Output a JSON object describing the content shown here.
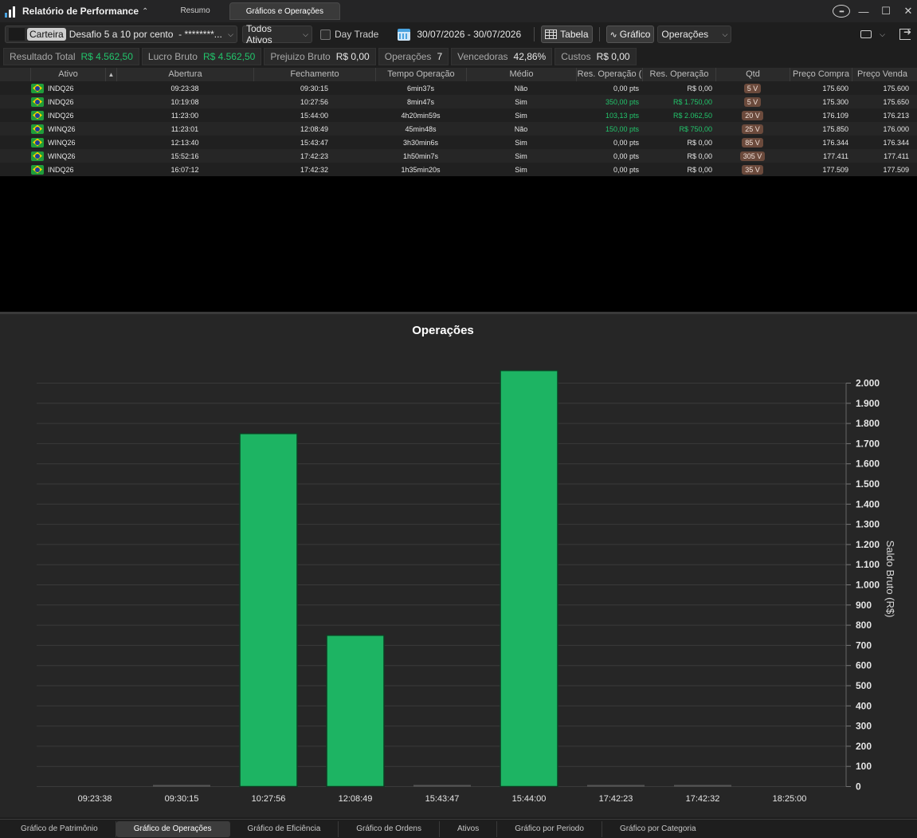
{
  "app": {
    "title": "Relatório de Performance",
    "tabs": [
      {
        "label": "Resumo",
        "active": false
      },
      {
        "label": "Gráficos e Operações",
        "active": true
      }
    ]
  },
  "toolbar": {
    "carteira_label": "Carteira",
    "carteira_value": "Desafio 5 a 10 por cento  - ********...",
    "ativos_select": "Todos Ativos",
    "day_trade_label": "Day Trade",
    "day_trade_checked": false,
    "date_range": "30/07/2026 - 30/07/2026",
    "tabela_label": "Tabela",
    "grafico_label": "Gráfico",
    "view_select": "Operações"
  },
  "summary": [
    {
      "label": "Resultado Total",
      "value": "R$ 4.562,50",
      "color": "green"
    },
    {
      "label": "Lucro Bruto",
      "value": "R$ 4.562,50",
      "color": "green"
    },
    {
      "label": "Prejuizo Bruto",
      "value": "R$ 0,00",
      "color": "normal"
    },
    {
      "label": "Operações",
      "value": "7",
      "color": "normal"
    },
    {
      "label": "Vencedoras",
      "value": "42,86%",
      "color": "normal"
    },
    {
      "label": "Custos",
      "value": "R$ 0,00",
      "color": "normal"
    }
  ],
  "table": {
    "headers": {
      "ativo": "Ativo",
      "abertura": "Abertura",
      "fechamento": "Fechamento",
      "tempo": "Tempo Operação",
      "medio": "Médio",
      "res_pts": "Res. Operação (",
      "res_brl": "Res. Operação",
      "qtd": "Qtd",
      "preco_compra": "Preço Compra",
      "preco_venda": "Preço Venda"
    },
    "rows": [
      {
        "ativo": "INDQ26",
        "abertura": "09:23:38",
        "fechamento": "09:30:15",
        "tempo": "6min37s",
        "medio": "Não",
        "res_pts": "0,00 pts",
        "res_brl": "R$ 0,00",
        "qtd": "5 V",
        "preco_compra": "175.600",
        "preco_venda": "175.600",
        "positive": false
      },
      {
        "ativo": "INDQ26",
        "abertura": "10:19:08",
        "fechamento": "10:27:56",
        "tempo": "8min47s",
        "medio": "Sim",
        "res_pts": "350,00 pts",
        "res_brl": "R$ 1.750,00",
        "qtd": "5 V",
        "preco_compra": "175.300",
        "preco_venda": "175.650",
        "positive": true
      },
      {
        "ativo": "INDQ26",
        "abertura": "11:23:00",
        "fechamento": "15:44:00",
        "tempo": "4h20min59s",
        "medio": "Sim",
        "res_pts": "103,13 pts",
        "res_brl": "R$ 2.062,50",
        "qtd": "20 V",
        "preco_compra": "176.109",
        "preco_venda": "176.213",
        "positive": true
      },
      {
        "ativo": "WINQ26",
        "abertura": "11:23:01",
        "fechamento": "12:08:49",
        "tempo": "45min48s",
        "medio": "Não",
        "res_pts": "150,00 pts",
        "res_brl": "R$ 750,00",
        "qtd": "25 V",
        "preco_compra": "175.850",
        "preco_venda": "176.000",
        "positive": true
      },
      {
        "ativo": "WINQ26",
        "abertura": "12:13:40",
        "fechamento": "15:43:47",
        "tempo": "3h30min6s",
        "medio": "Sim",
        "res_pts": "0,00 pts",
        "res_brl": "R$ 0,00",
        "qtd": "85 V",
        "preco_compra": "176.344",
        "preco_venda": "176.344",
        "positive": false
      },
      {
        "ativo": "WINQ26",
        "abertura": "15:52:16",
        "fechamento": "17:42:23",
        "tempo": "1h50min7s",
        "medio": "Sim",
        "res_pts": "0,00 pts",
        "res_brl": "R$ 0,00",
        "qtd": "305 V",
        "preco_compra": "177.411",
        "preco_venda": "177.411",
        "positive": false
      },
      {
        "ativo": "INDQ26",
        "abertura": "16:07:12",
        "fechamento": "17:42:32",
        "tempo": "1h35min20s",
        "medio": "Sim",
        "res_pts": "0,00 pts",
        "res_brl": "R$ 0,00",
        "qtd": "35 V",
        "preco_compra": "177.509",
        "preco_venda": "177.509",
        "positive": false
      }
    ]
  },
  "chart_data": {
    "type": "bar",
    "title": "Operações",
    "ylabel": "Saldo Bruto (R$)",
    "xlabel": "",
    "categories": [
      "09:23:38",
      "09:30:15",
      "10:27:56",
      "12:08:49",
      "15:43:47",
      "15:44:00",
      "17:42:23",
      "17:42:32",
      "18:25:00"
    ],
    "values": [
      0,
      0,
      1750,
      750,
      0,
      2062.5,
      0,
      0,
      0
    ],
    "bars_at": [
      1,
      2,
      3,
      4,
      5,
      6,
      7
    ],
    "ylim": [
      0,
      2000
    ],
    "yticks": [
      0,
      100,
      200,
      300,
      400,
      500,
      600,
      700,
      800,
      900,
      1000,
      1100,
      1200,
      1300,
      1400,
      1500,
      1600,
      1700,
      1800,
      1900,
      2000
    ],
    "ytick_labels": [
      "0",
      "100",
      "200",
      "300",
      "400",
      "500",
      "600",
      "700",
      "800",
      "900",
      "1.000",
      "1.100",
      "1.200",
      "1.300",
      "1.400",
      "1.500",
      "1.600",
      "1.700",
      "1.800",
      "1.900",
      "2.000"
    ],
    "grid": true,
    "y_axis_side": "right",
    "bar_color": "#1db463",
    "zero_bar_color": "#555555"
  },
  "bottom_tabs": [
    {
      "label": "Gráfico de Patrimônio",
      "active": false
    },
    {
      "label": "Gráfico de Operações",
      "active": true
    },
    {
      "label": "Gráfico de Eficiência",
      "active": false
    },
    {
      "label": "Gráfico de Ordens",
      "active": false
    },
    {
      "label": "Ativos",
      "active": false
    },
    {
      "label": "Gráfico por Periodo",
      "active": false
    },
    {
      "label": "Gráfico por Categoria",
      "active": false
    }
  ],
  "icons": {
    "logo": "bar-chart-logo-icon",
    "menu": "more-options-icon",
    "calendar": "calendar-icon",
    "print": "print-icon",
    "exit": "exit-icon"
  }
}
